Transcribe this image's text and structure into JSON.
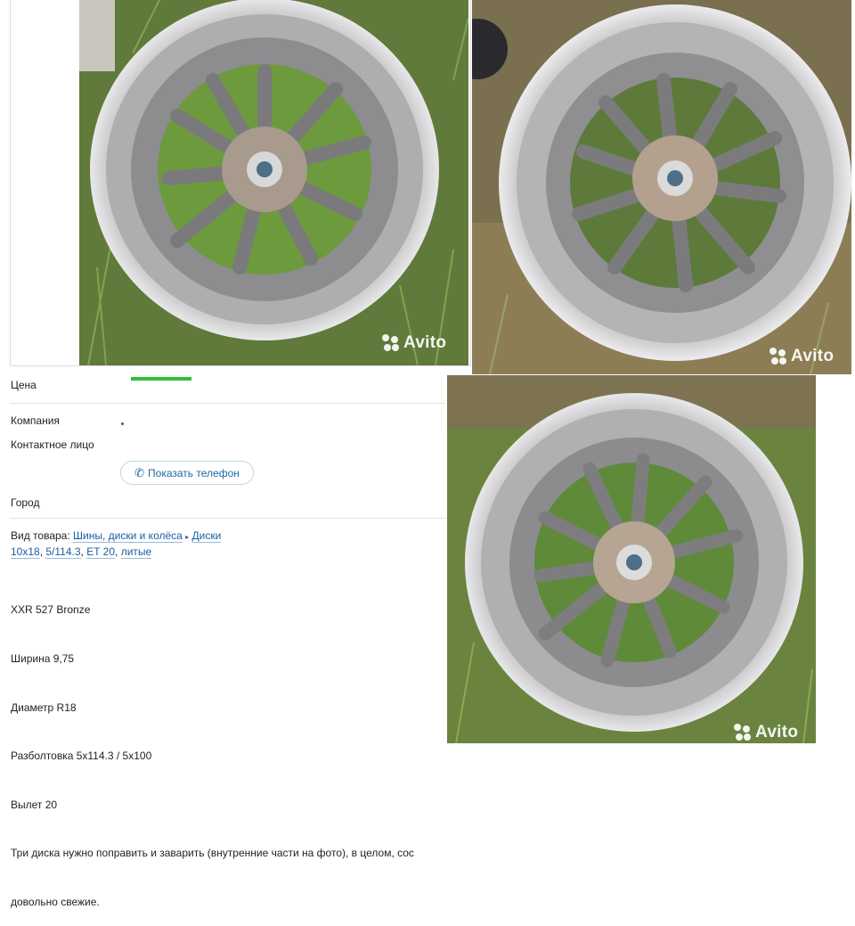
{
  "listing": {
    "price_label": "Цена",
    "company_label": "Компания",
    "contact_label": "Контактное лицо",
    "show_phone_button": "Показать телефон",
    "city_label": "Город",
    "category_prefix": "Вид товара:",
    "category_links": [
      "Шины, диски и колёса",
      "Диски"
    ],
    "tags": [
      "10x18",
      "5/114.3",
      "ET 20",
      "литые"
    ],
    "description_lines": [
      "XXR 527 Bronze",
      "Ширина 9,75",
      "Диаметр R18",
      "Разболтовка 5x114.3 / 5x100",
      "Вылет 20",
      "Три диска нужно поправить и заварить (внутренние части на фото), в целом, сос",
      "довольно свежие."
    ]
  },
  "photos": {
    "watermark": "Avito",
    "count": 3
  },
  "colors": {
    "link": "#1a5ea0",
    "price_bar": "#2fbf3a",
    "button_border": "#b9d6ea"
  }
}
